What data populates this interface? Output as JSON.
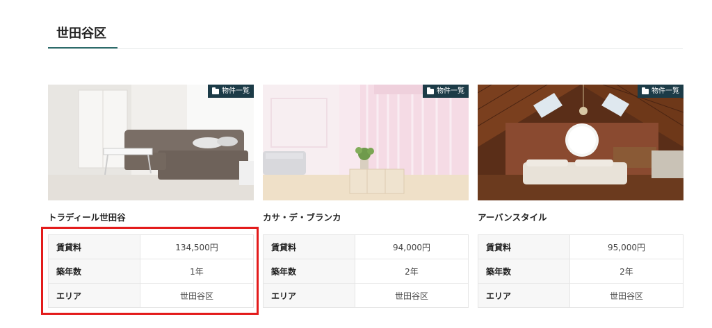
{
  "section": {
    "title": "世田谷区"
  },
  "colors": {
    "accent": "#2d6b6a",
    "badge_bg": "#1c3b47",
    "highlight": "#e31b1b"
  },
  "cards": [
    {
      "category": "物件一覧",
      "category_icon": "folder-icon",
      "name": "トラディール世田谷",
      "image": "living-room-with-gray-sofa",
      "specs": [
        {
          "label": "賃貸料",
          "value": "134,500円"
        },
        {
          "label": "築年数",
          "value": "1年"
        },
        {
          "label": "エリア",
          "value": "世田谷区"
        }
      ]
    },
    {
      "category": "物件一覧",
      "category_icon": "folder-icon",
      "name": "カサ・デ・ブランカ",
      "image": "pink-curtain-room",
      "specs": [
        {
          "label": "賃貸料",
          "value": "94,000円"
        },
        {
          "label": "築年数",
          "value": "2年"
        },
        {
          "label": "エリア",
          "value": "世田谷区"
        }
      ]
    },
    {
      "category": "物件一覧",
      "category_icon": "folder-icon",
      "name": "アーバンスタイル",
      "image": "attic-bedroom",
      "specs": [
        {
          "label": "賃貸料",
          "value": "95,000円"
        },
        {
          "label": "築年数",
          "value": "2年"
        },
        {
          "label": "エリア",
          "value": "世田谷区"
        }
      ]
    }
  ]
}
